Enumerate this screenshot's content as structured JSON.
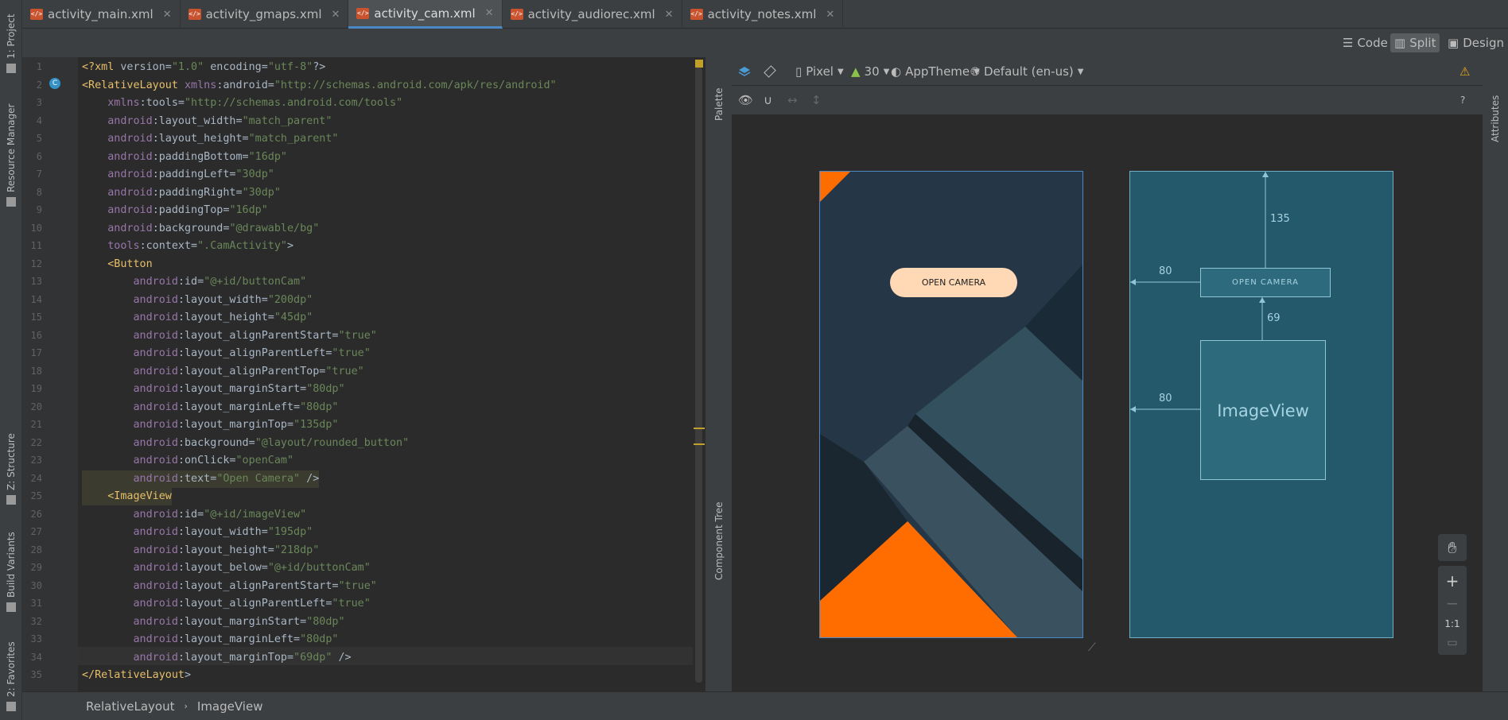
{
  "left_tools": [
    "1: Project",
    "Resource Manager",
    "Z: Structure",
    "Build Variants",
    "2: Favorites"
  ],
  "tabs": [
    {
      "label": "activity_main.xml"
    },
    {
      "label": "activity_gmaps.xml"
    },
    {
      "label": "activity_cam.xml",
      "active": true
    },
    {
      "label": "activity_audiorec.xml"
    },
    {
      "label": "activity_notes.xml"
    }
  ],
  "view_modes": {
    "code": "Code",
    "split": "Split",
    "design": "Design",
    "selected": "Split"
  },
  "code_lines": [
    "<?xml version=\"1.0\" encoding=\"utf-8\"?>",
    "<RelativeLayout xmlns:android=\"http://schemas.android.com/apk/res/android\"",
    "    xmlns:tools=\"http://schemas.android.com/tools\"",
    "    android:layout_width=\"match_parent\"",
    "    android:layout_height=\"match_parent\"",
    "    android:paddingBottom=\"16dp\"",
    "    android:paddingLeft=\"30dp\"",
    "    android:paddingRight=\"30dp\"",
    "    android:paddingTop=\"16dp\"",
    "    android:background=\"@drawable/bg\"",
    "    tools:context=\".CamActivity\">",
    "    <Button",
    "        android:id=\"@+id/buttonCam\"",
    "        android:layout_width=\"200dp\"",
    "        android:layout_height=\"45dp\"",
    "        android:layout_alignParentStart=\"true\"",
    "        android:layout_alignParentLeft=\"true\"",
    "        android:layout_alignParentTop=\"true\"",
    "        android:layout_marginStart=\"80dp\"",
    "        android:layout_marginLeft=\"80dp\"",
    "        android:layout_marginTop=\"135dp\"",
    "        android:background=\"@layout/rounded_button\"",
    "        android:onClick=\"openCam\"",
    "        android:text=\"Open Camera\" />",
    "    <ImageView",
    "        android:id=\"@+id/imageView\"",
    "        android:layout_width=\"195dp\"",
    "        android:layout_height=\"218dp\"",
    "        android:layout_below=\"@+id/buttonCam\"",
    "        android:layout_alignParentStart=\"true\"",
    "        android:layout_alignParentLeft=\"true\"",
    "        android:layout_marginStart=\"80dp\"",
    "        android:layout_marginLeft=\"80dp\"",
    "        android:layout_marginTop=\"69dp\" />",
    "</RelativeLayout>"
  ],
  "design_toolbar": {
    "device": "Pixel",
    "api": "30",
    "theme": "AppTheme",
    "locale": "Default (en-us)"
  },
  "side_panels": {
    "palette": "Palette",
    "component_tree": "Component Tree",
    "attributes": "Attributes"
  },
  "preview": {
    "button_text": "OPEN CAMERA",
    "accent": "#ff6d00",
    "bg": "#253746"
  },
  "blueprint": {
    "button_text": "OPEN CAMERA",
    "image_label": "ImageView",
    "dim_top": "135",
    "dim_left_button": "80",
    "dim_between": "69",
    "dim_left_image": "80"
  },
  "zoom": {
    "fit": "1:1"
  },
  "breadcrumb": [
    "RelativeLayout",
    "ImageView"
  ]
}
